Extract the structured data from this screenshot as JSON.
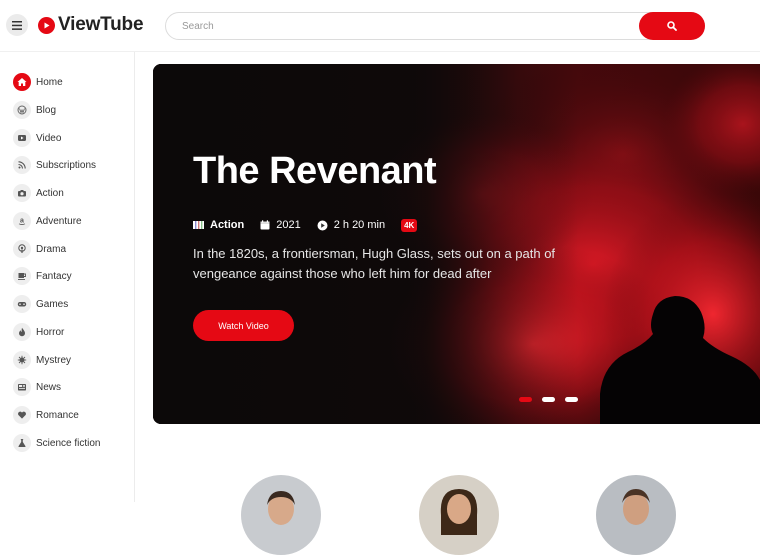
{
  "header": {
    "logo_text": "ViewTube",
    "search_placeholder": "Search"
  },
  "sidebar": {
    "items": [
      {
        "label": "Home",
        "icon": "home-icon",
        "active": true
      },
      {
        "label": "Blog",
        "icon": "wordpress-icon"
      },
      {
        "label": "Video",
        "icon": "video-icon"
      },
      {
        "label": "Subscriptions",
        "icon": "rss-icon"
      },
      {
        "label": "Action",
        "icon": "camera-icon"
      },
      {
        "label": "Adventure",
        "icon": "amazon-icon"
      },
      {
        "label": "Drama",
        "icon": "podcast-icon"
      },
      {
        "label": "Fantacy",
        "icon": "coffee-icon"
      },
      {
        "label": "Games",
        "icon": "gamepad-icon"
      },
      {
        "label": "Horror",
        "icon": "fire-icon"
      },
      {
        "label": "Mystrey",
        "icon": "virus-icon"
      },
      {
        "label": "News",
        "icon": "newspaper-icon"
      },
      {
        "label": "Romance",
        "icon": "heart-icon"
      },
      {
        "label": "Science fiction",
        "icon": "flask-icon"
      }
    ]
  },
  "hero": {
    "title": "The Revenant",
    "genre": "Action",
    "year": "2021",
    "duration": "2 h 20 min",
    "quality": "4K",
    "description": "In the 1820s, a frontiersman, Hugh Glass, sets out on a path of vengeance against those who left him for dead after",
    "watch_label": "Watch Video",
    "slide_count": 3,
    "active_slide": 1
  },
  "colors": {
    "accent": "#e50914",
    "hero_bg": "#120708"
  }
}
